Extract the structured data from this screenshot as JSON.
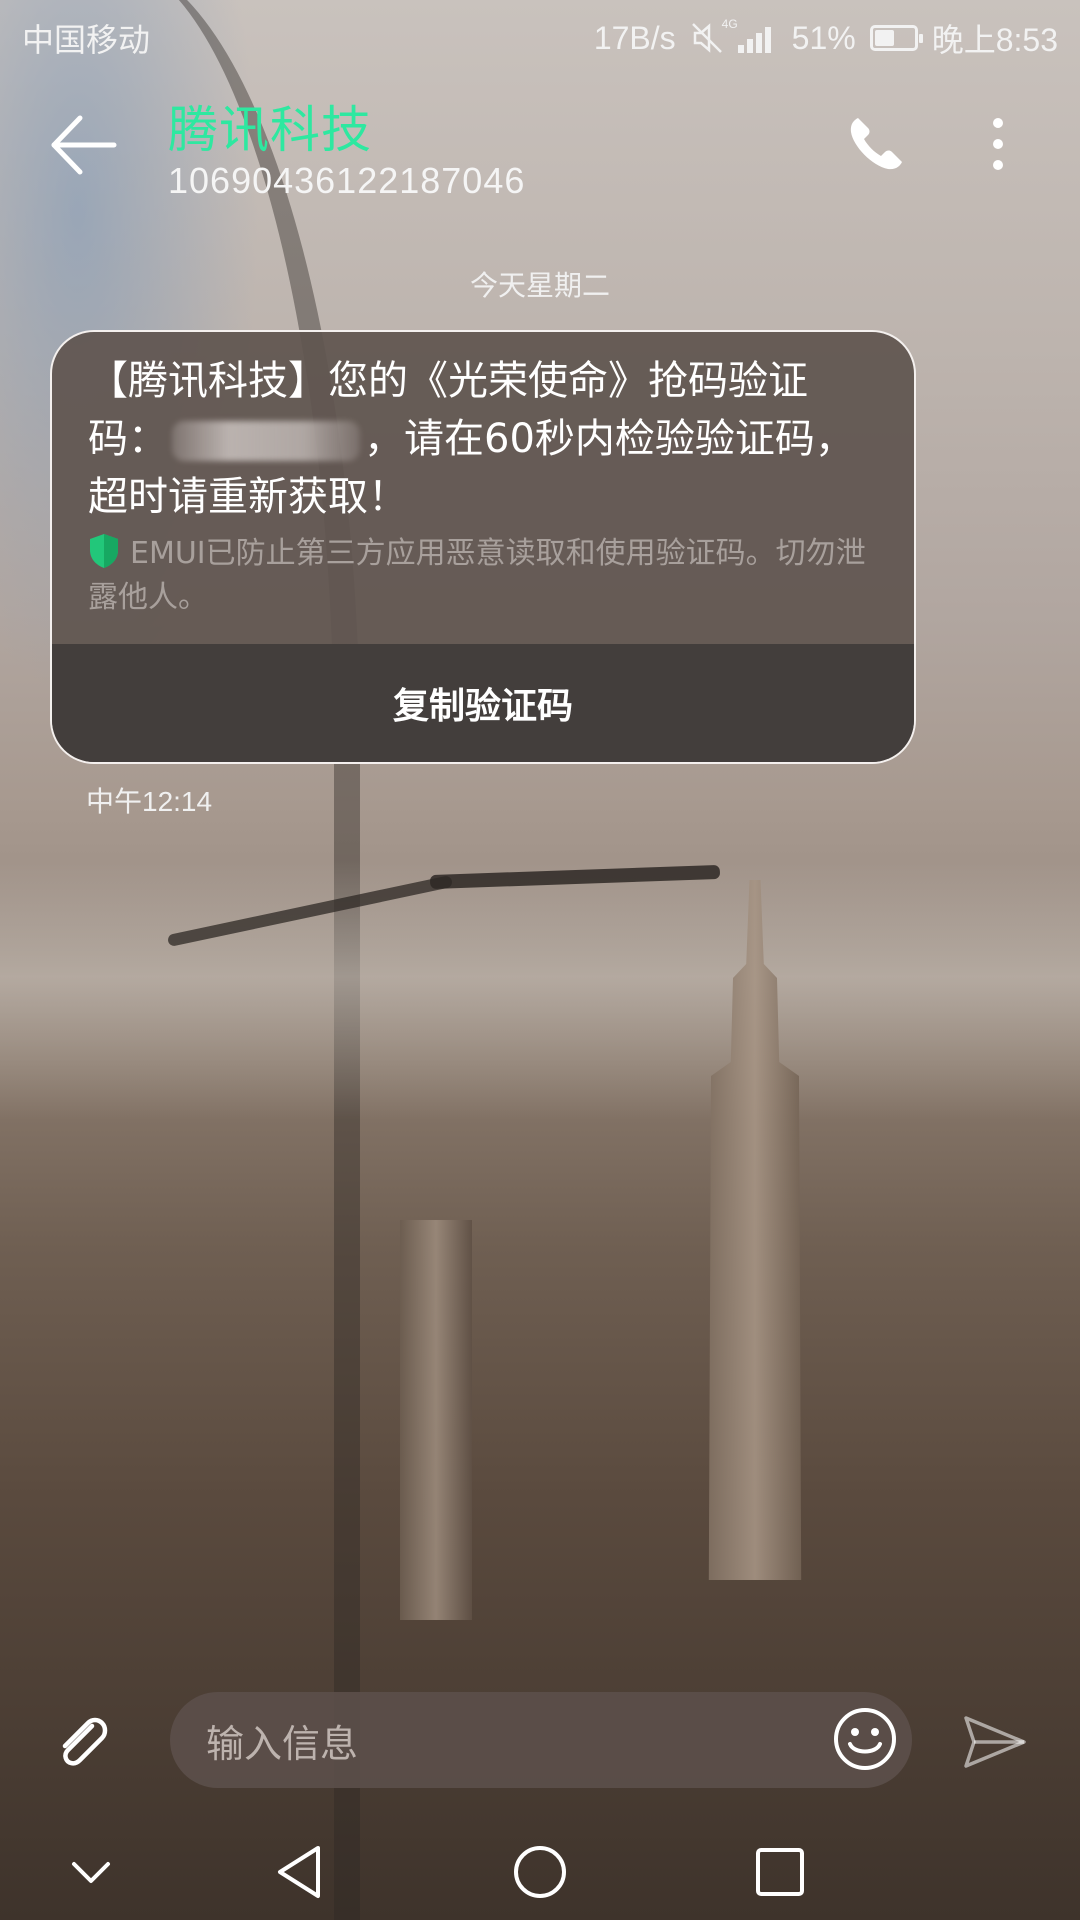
{
  "status_bar": {
    "carrier": "中国移动",
    "net_speed": "17B/s",
    "network_type": "4G",
    "battery_percent": "51%",
    "battery_level": 0.51,
    "time": "晚上8:53"
  },
  "header": {
    "contact_name": "腾讯科技",
    "contact_number": "10690436122187046",
    "accent_color": "#2ee8a0"
  },
  "conversation": {
    "date_separator": "今天星期二",
    "message": {
      "text_part1": "【腾讯科技】您的《光荣使命》抢码验证码：",
      "text_part2": "，请在60秒内检验验证码，超时请重新获取！",
      "security_notice": "EMUI已防止第三方应用恶意读取和使用验证码。切勿泄露他人。",
      "copy_button_label": "复制验证码",
      "time": "中午12:14"
    }
  },
  "composer": {
    "placeholder": "输入信息"
  },
  "icons": {
    "back": "arrow-left-icon",
    "call": "phone-icon",
    "more": "more-vertical-icon",
    "attach": "paperclip-icon",
    "emoji": "smiley-icon",
    "send": "send-icon",
    "shield": "shield-icon"
  }
}
